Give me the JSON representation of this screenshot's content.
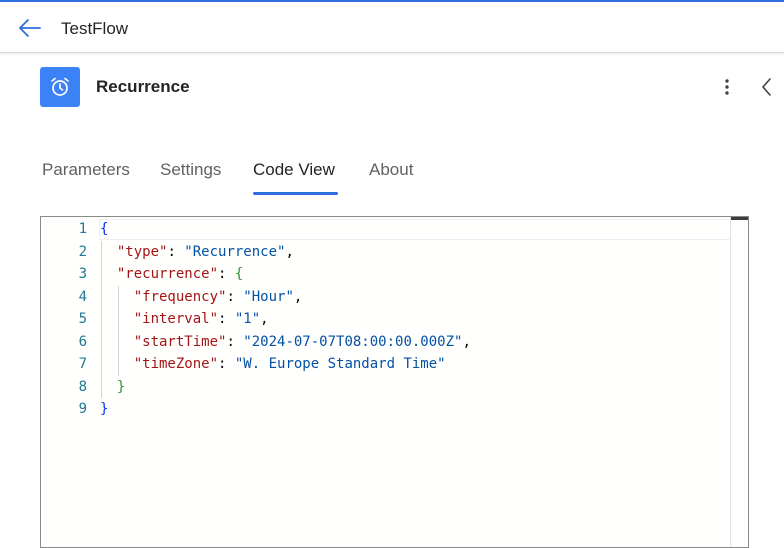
{
  "header": {
    "title": "TestFlow",
    "accent_color": "#2f6fde"
  },
  "action": {
    "icon": "alarm-clock-icon",
    "icon_bg": "#3b82f6",
    "title": "Recurrence"
  },
  "tabs": [
    {
      "label": "Parameters",
      "active": false
    },
    {
      "label": "Settings",
      "active": false
    },
    {
      "label": "Code View",
      "active": true
    },
    {
      "label": "About",
      "active": false
    }
  ],
  "editor": {
    "lines": [
      {
        "n": "1",
        "tokens": [
          {
            "t": "{",
            "c": "b1"
          }
        ]
      },
      {
        "n": "2",
        "tokens": [
          {
            "t": "  ",
            "c": "p"
          },
          {
            "t": "\"type\"",
            "c": "k"
          },
          {
            "t": ": ",
            "c": "p"
          },
          {
            "t": "\"Recurrence\"",
            "c": "s"
          },
          {
            "t": ",",
            "c": "p"
          }
        ]
      },
      {
        "n": "3",
        "tokens": [
          {
            "t": "  ",
            "c": "p"
          },
          {
            "t": "\"recurrence\"",
            "c": "k"
          },
          {
            "t": ": ",
            "c": "p"
          },
          {
            "t": "{",
            "c": "b2"
          }
        ]
      },
      {
        "n": "4",
        "tokens": [
          {
            "t": "    ",
            "c": "p"
          },
          {
            "t": "\"frequency\"",
            "c": "k"
          },
          {
            "t": ": ",
            "c": "p"
          },
          {
            "t": "\"Hour\"",
            "c": "s"
          },
          {
            "t": ",",
            "c": "p"
          }
        ]
      },
      {
        "n": "5",
        "tokens": [
          {
            "t": "    ",
            "c": "p"
          },
          {
            "t": "\"interval\"",
            "c": "k"
          },
          {
            "t": ": ",
            "c": "p"
          },
          {
            "t": "\"1\"",
            "c": "s"
          },
          {
            "t": ",",
            "c": "p"
          }
        ]
      },
      {
        "n": "6",
        "tokens": [
          {
            "t": "    ",
            "c": "p"
          },
          {
            "t": "\"startTime\"",
            "c": "k"
          },
          {
            "t": ": ",
            "c": "p"
          },
          {
            "t": "\"2024-07-07T08:00:00.000Z\"",
            "c": "s"
          },
          {
            "t": ",",
            "c": "p"
          }
        ]
      },
      {
        "n": "7",
        "tokens": [
          {
            "t": "    ",
            "c": "p"
          },
          {
            "t": "\"timeZone\"",
            "c": "k"
          },
          {
            "t": ": ",
            "c": "p"
          },
          {
            "t": "\"W. Europe Standard Time\"",
            "c": "s"
          }
        ]
      },
      {
        "n": "8",
        "tokens": [
          {
            "t": "  ",
            "c": "p"
          },
          {
            "t": "}",
            "c": "b2"
          }
        ]
      },
      {
        "n": "9",
        "tokens": [
          {
            "t": "}",
            "c": "b1"
          }
        ]
      }
    ]
  }
}
